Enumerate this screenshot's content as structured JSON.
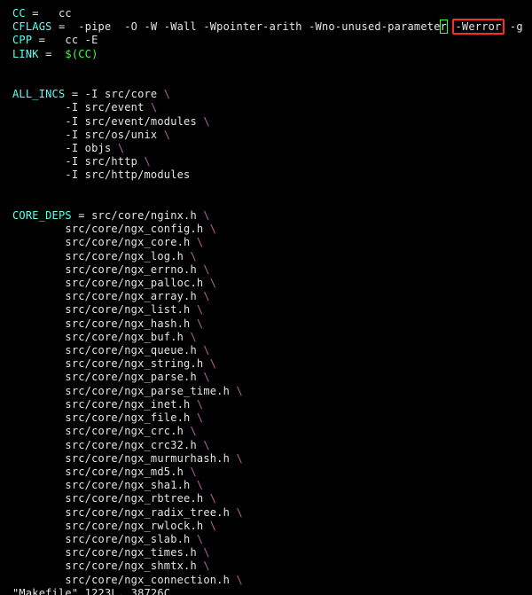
{
  "vars": {
    "cc_name": "CC",
    "cc_eq": " =   ",
    "cc_val": "cc",
    "cflags_name": "CFLAGS",
    "cflags_eq": " =  ",
    "cflags_val_pre": "-pipe  -O -W -Wall -Wpointer-arith -Wno-unused-paramete",
    "cflags_cur": "r",
    "cflags_val_gap": " ",
    "cflags_hl": "-Werror",
    "cflags_val_post": " -g",
    "cpp_name": "CPP",
    "cpp_eq": " =   ",
    "cpp_val": "cc -E",
    "link_name": "LINK",
    "link_eq": " =  ",
    "link_val": "$(CC)"
  },
  "all_incs": {
    "name": "ALL_INCS",
    "eq": " = ",
    "items": [
      "-I src/core",
      "-I src/event",
      "-I src/event/modules",
      "-I src/os/unix",
      "-I objs",
      "-I src/http",
      "-I src/http/modules"
    ]
  },
  "core_deps": {
    "name": "CORE_DEPS",
    "eq": " = ",
    "items": [
      "src/core/nginx.h",
      "src/core/ngx_config.h",
      "src/core/ngx_core.h",
      "src/core/ngx_log.h",
      "src/core/ngx_errno.h",
      "src/core/ngx_palloc.h",
      "src/core/ngx_array.h",
      "src/core/ngx_list.h",
      "src/core/ngx_hash.h",
      "src/core/ngx_buf.h",
      "src/core/ngx_queue.h",
      "src/core/ngx_string.h",
      "src/core/ngx_parse.h",
      "src/core/ngx_parse_time.h",
      "src/core/ngx_inet.h",
      "src/core/ngx_file.h",
      "src/core/ngx_crc.h",
      "src/core/ngx_crc32.h",
      "src/core/ngx_murmurhash.h",
      "src/core/ngx_md5.h",
      "src/core/ngx_sha1.h",
      "src/core/ngx_rbtree.h",
      "src/core/ngx_radix_tree.h",
      "src/core/ngx_rwlock.h",
      "src/core/ngx_slab.h",
      "src/core/ngx_times.h",
      "src/core/ngx_shmtx.h",
      "src/core/ngx_connection.h"
    ]
  },
  "continuation_indent": "\t",
  "backslash": "\\",
  "status": "\"Makefile\" 1223L, 38726C"
}
